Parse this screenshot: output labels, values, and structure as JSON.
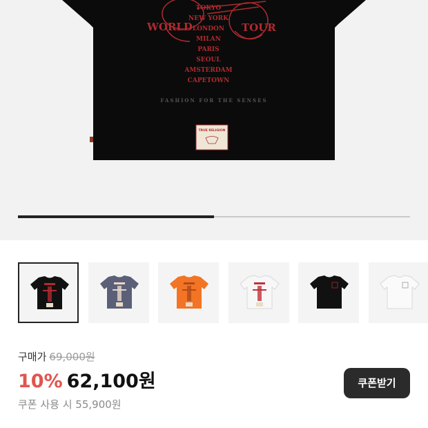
{
  "hero": {
    "print_left": "WORLD",
    "print_right": "TOUR",
    "cities": [
      "TOKYO",
      "NEW YORK",
      "LONDON",
      "MILAN",
      "PARIS",
      "SEOUL",
      "AMSTERDAM",
      "CAPETOWN"
    ],
    "footer_line": "FASHION FOR THE SENSES",
    "label_text": "TRUE RELIGION"
  },
  "gallery_progress": 0.5,
  "thumbnails": [
    {
      "color": "black",
      "selected": true
    },
    {
      "color": "navy",
      "selected": false
    },
    {
      "color": "orange",
      "selected": false
    },
    {
      "color": "white",
      "selected": false
    },
    {
      "color": "black-plain",
      "selected": false
    },
    {
      "color": "white-plain",
      "selected": false
    }
  ],
  "price": {
    "label": "구매가",
    "original": "69,000원",
    "discount": "10%",
    "sale": "62,100원",
    "coupon_price": "쿠폰 사용 시 55,900원"
  },
  "coupon_button": "쿠폰받기",
  "colors": {
    "discount": "#e2544f",
    "print_red": "#b02a2e",
    "shirt_black": "#0b0b0b"
  }
}
